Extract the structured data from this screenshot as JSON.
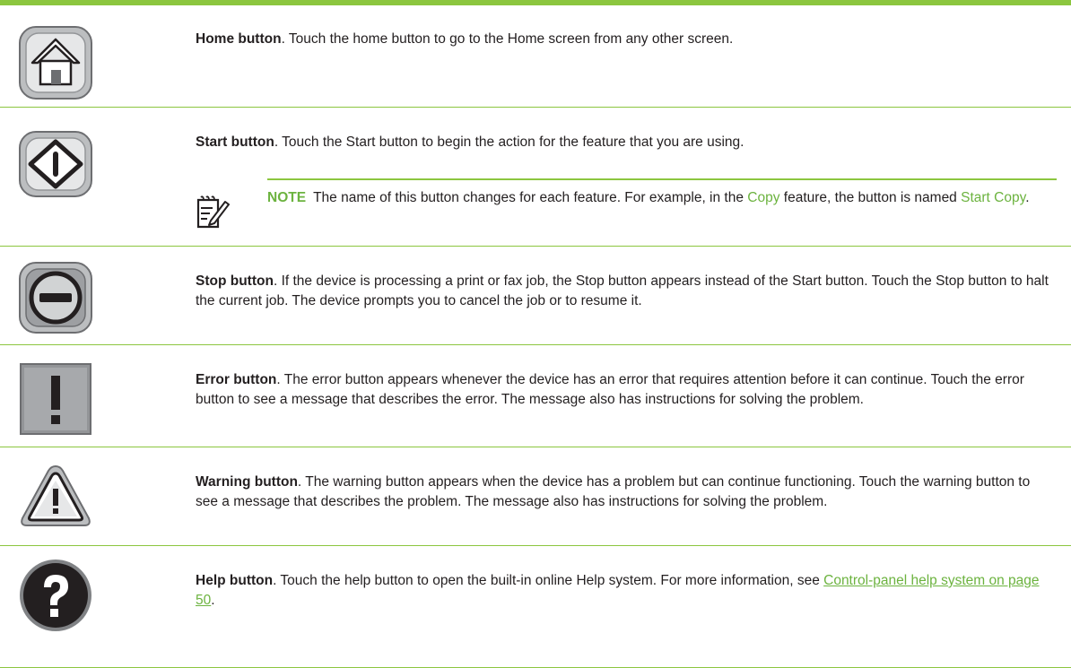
{
  "rows": [
    {
      "title": "Home button",
      "desc": ". Touch the home button to go to the Home screen from any other screen.",
      "icon": "home-icon"
    },
    {
      "title": "Start button",
      "desc": ". Touch the Start button to begin the action for the feature that you are using.",
      "icon": "start-icon",
      "note": {
        "label": "NOTE",
        "text_1": "The name of this button changes for each feature. For example, in the ",
        "link_1": "Copy",
        "text_2": " feature, the button is named ",
        "link_2": "Start Copy",
        "text_3": "."
      }
    },
    {
      "title": "Stop button",
      "desc": ". If the device is processing a print or fax job, the Stop button appears instead of the Start button. Touch the Stop button to halt the current job. The device prompts you to cancel the job or to resume it.",
      "icon": "stop-icon"
    },
    {
      "title": "Error button",
      "desc": ". The error button appears whenever the device has an error that requires attention before it can continue. Touch the error button to see a message that describes the error. The message also has instructions for solving the problem.",
      "icon": "error-icon"
    },
    {
      "title": "Warning button",
      "desc": ". The warning button appears when the device has a problem but can continue functioning. Touch the warning button to see a message that describes the problem. The message also has instructions for solving the problem.",
      "icon": "warning-icon"
    },
    {
      "title": "Help button",
      "desc": ". Touch the help button to open the built-in online Help system. For more information, see ",
      "link": "Control-panel help system on page 50",
      "after_link": ".",
      "icon": "help-icon"
    }
  ],
  "colors": {
    "accent": "#8cc63f",
    "link": "#6cb33f",
    "text": "#231f20"
  }
}
